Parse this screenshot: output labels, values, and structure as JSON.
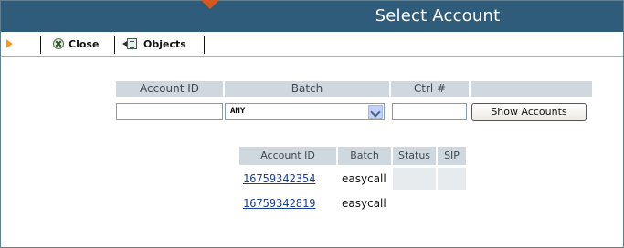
{
  "window": {
    "title": "Select Account"
  },
  "toolbar": {
    "close_label": "Close",
    "objects_label": "Objects"
  },
  "filters": {
    "headers": [
      "Account ID",
      "Batch",
      "Ctrl #"
    ],
    "account_id_value": "",
    "batch_value": "ANY",
    "ctrl_value": "",
    "show_button_label": "Show Accounts"
  },
  "results": {
    "columns": [
      "Account ID",
      "Batch",
      "Status",
      "SIP"
    ],
    "rows": [
      {
        "account_id": "16759342354",
        "batch": "easycall",
        "status": "",
        "sip": ""
      },
      {
        "account_id": "16759342819",
        "batch": "easycall",
        "status": "",
        "sip": ""
      }
    ]
  },
  "colors": {
    "titlebar": "#2f5c7b",
    "header_bg": "#cfd8de",
    "link": "#1b3f8f",
    "accent_arrow": "#ff9b1a",
    "pointer": "#d8571f"
  }
}
